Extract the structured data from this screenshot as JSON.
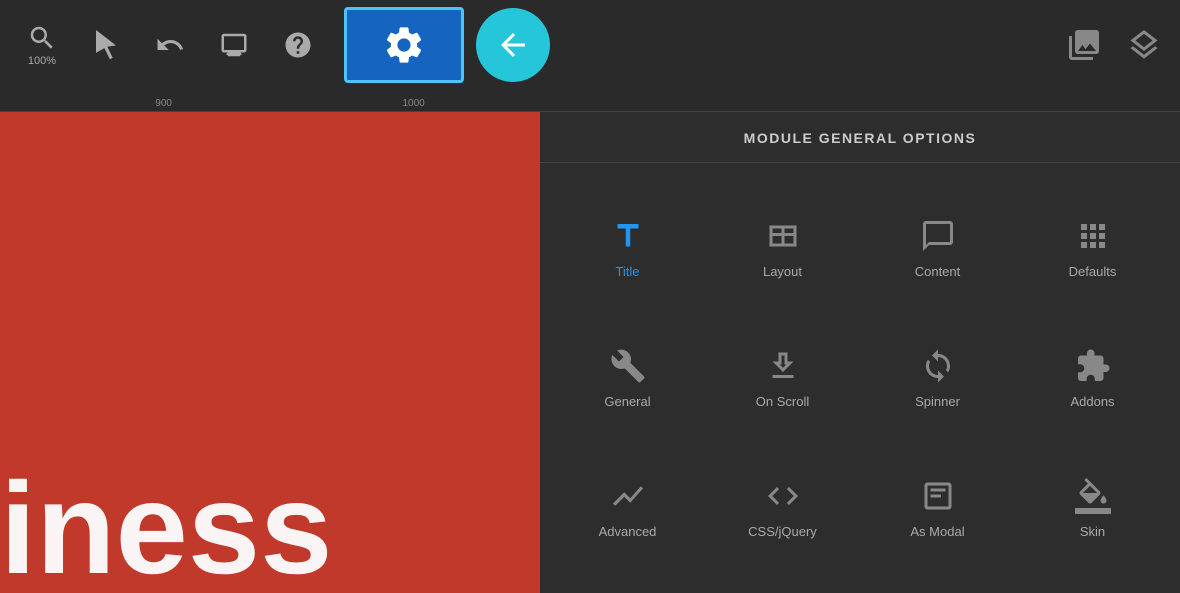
{
  "toolbar": {
    "zoom_label": "100%",
    "settings_label": "Settings",
    "back_label": "Back",
    "media_label": "Media",
    "layers_label": "Layers"
  },
  "ruler": {
    "marks": [
      "900",
      "1000"
    ]
  },
  "panel": {
    "title": "MODULE GENERAL OPTIONS",
    "options": [
      {
        "id": "title",
        "label": "Title",
        "active": false
      },
      {
        "id": "layout",
        "label": "Layout",
        "active": false
      },
      {
        "id": "content",
        "label": "Content",
        "active": false
      },
      {
        "id": "defaults",
        "label": "Defaults",
        "active": false
      },
      {
        "id": "general",
        "label": "General",
        "active": false
      },
      {
        "id": "on-scroll",
        "label": "On Scroll",
        "active": false
      },
      {
        "id": "spinner",
        "label": "Spinner",
        "active": false
      },
      {
        "id": "addons",
        "label": "Addons",
        "active": false
      },
      {
        "id": "advanced",
        "label": "Advanced",
        "active": false
      },
      {
        "id": "css-jquery",
        "label": "CSS/jQuery",
        "active": false
      },
      {
        "id": "as-modal",
        "label": "As Modal",
        "active": false
      },
      {
        "id": "skin",
        "label": "Skin",
        "active": false
      }
    ]
  },
  "canvas": {
    "text": "iness"
  }
}
